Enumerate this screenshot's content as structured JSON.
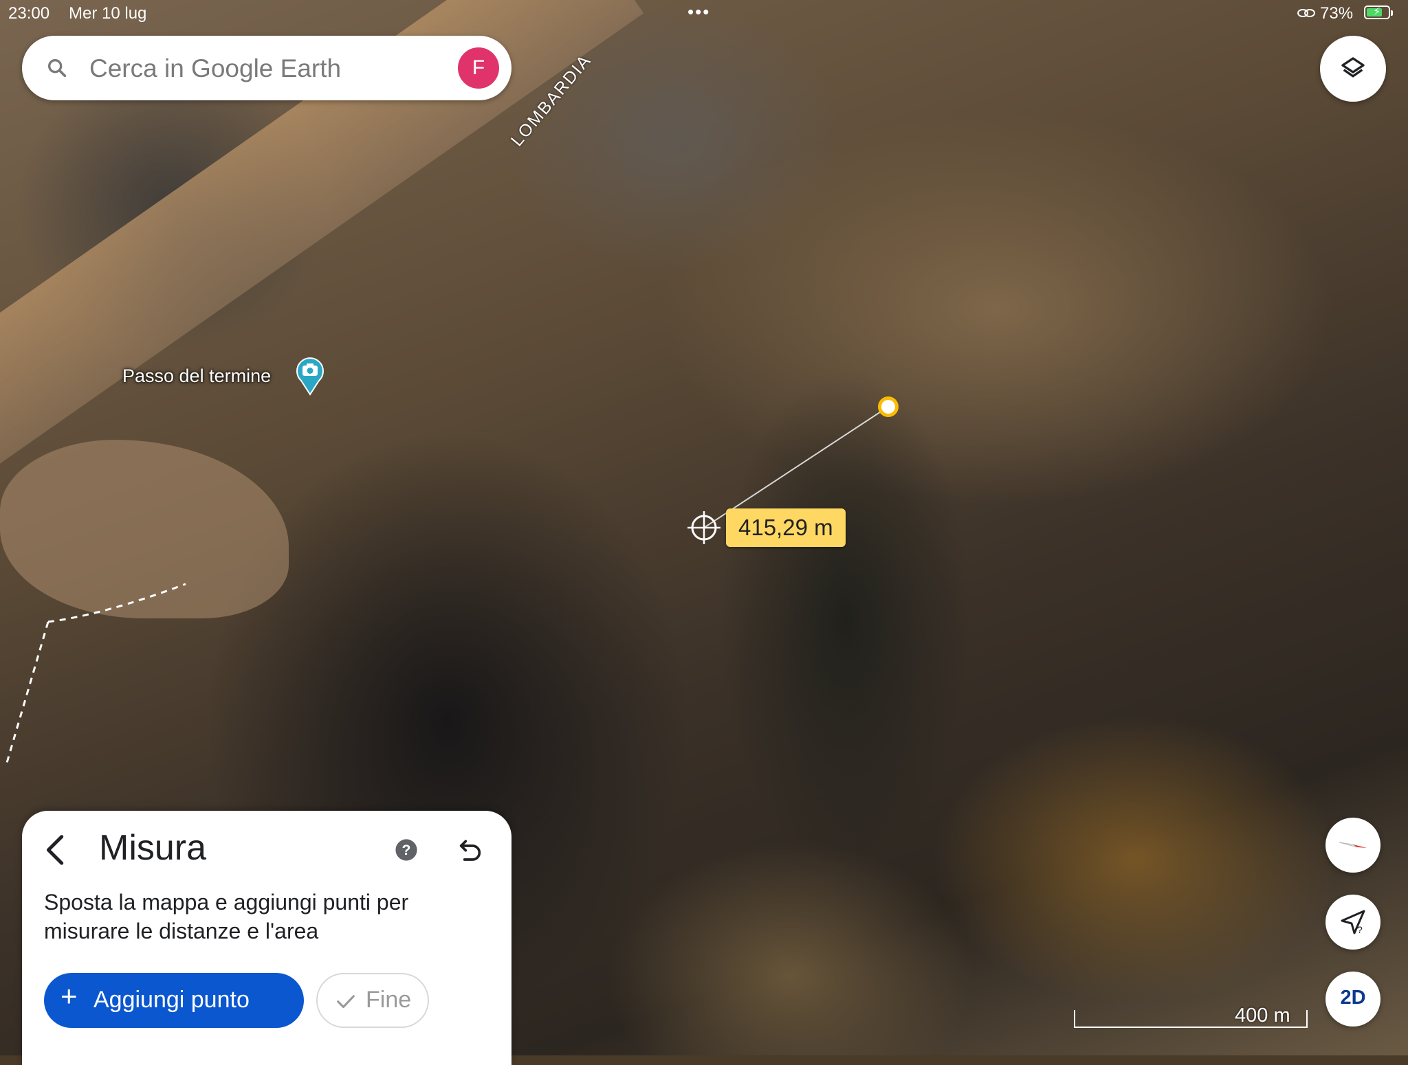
{
  "status_bar": {
    "time": "23:00",
    "date": "Mer 10 lug",
    "dots": "•••",
    "battery_percent": "73%",
    "battery_level": 0.73,
    "battery_color": "#4cd964"
  },
  "search": {
    "placeholder": "Cerca in Google Earth",
    "value": "",
    "icon": "search-icon"
  },
  "account": {
    "initial": "F",
    "color": "#e0336b"
  },
  "layers": {
    "icon": "layers-icon"
  },
  "map": {
    "region_label": "LOMBARDIA",
    "poi": {
      "label": "Passo del termine",
      "icon": "camera-pin-icon",
      "color": "#2aa7c4"
    },
    "measurement": {
      "distance": "415,29 m",
      "label_color": "#fed862",
      "point_color": "#fbbc04"
    },
    "scale": "400 m"
  },
  "measure_panel": {
    "title": "Misura",
    "description": "Sposta la mappa e aggiungi punti per misurare le distanze e l'area",
    "add_point_label": "Aggiungi punto",
    "done_label": "Fine",
    "accent": "#0b57d0"
  },
  "controls": {
    "view_mode": "2D"
  }
}
